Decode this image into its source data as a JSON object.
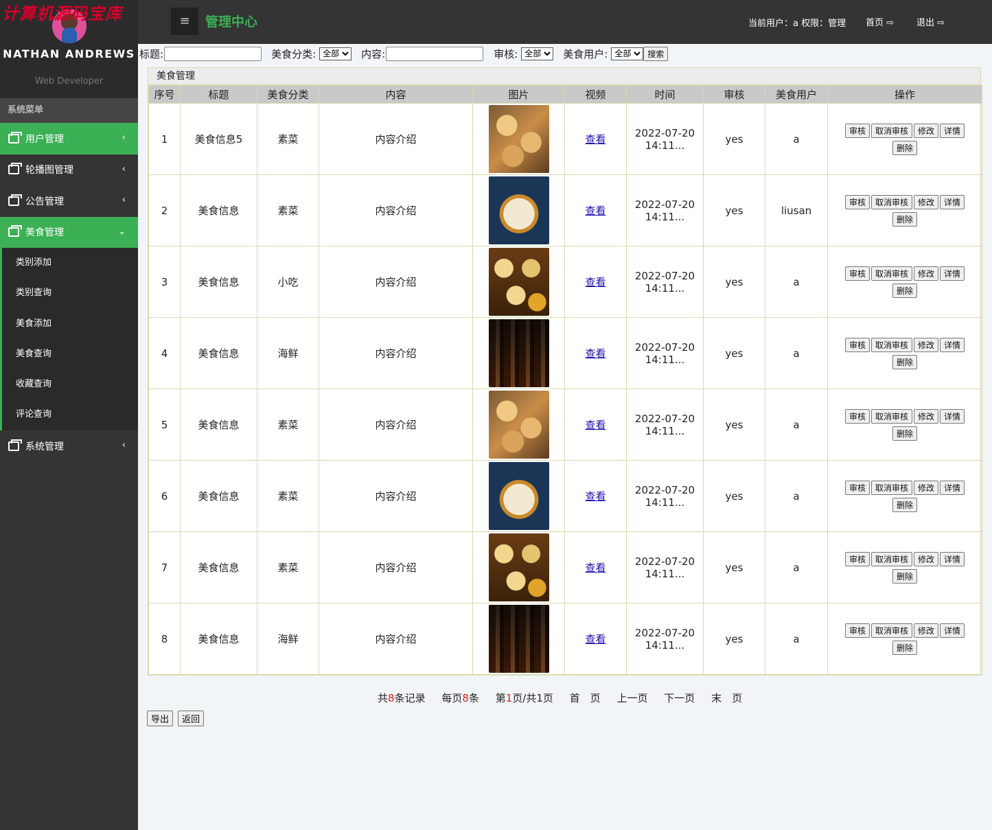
{
  "watermark": "计算机源码宝库",
  "profile": {
    "name": "NATHAN ANDREWS",
    "role": "Web Developer"
  },
  "sidebar": {
    "title": "系统菜单",
    "items": [
      {
        "label": "用户管理",
        "arrow": "‹"
      },
      {
        "label": "轮播图管理",
        "arrow": "‹"
      },
      {
        "label": "公告管理",
        "arrow": "‹"
      },
      {
        "label": "美食管理",
        "arrow": "⌄"
      }
    ],
    "subitems": [
      "类别添加",
      "类别查询",
      "美食添加",
      "美食查询",
      "收藏查询",
      "评论查询"
    ],
    "system": {
      "label": "系统管理",
      "arrow": "‹"
    }
  },
  "topbar": {
    "menu_icon": "≡",
    "title": "管理中心",
    "user_info": "当前用户：a 权限：管理",
    "home": "首页",
    "logout": "退出"
  },
  "search": {
    "title_label": "标题:",
    "category_label": "美食分类:",
    "category_value": "全部",
    "content_label": "内容:",
    "audit_label": "审核:",
    "audit_value": "全部",
    "user_label": "美食用户:",
    "user_value": "全部",
    "search_button": "搜索"
  },
  "panel_title": "美食管理",
  "columns": [
    "序号",
    "标题",
    "美食分类",
    "内容",
    "图片",
    "视频",
    "时间",
    "审核",
    "美食用户",
    "操作"
  ],
  "rows": [
    {
      "no": "1",
      "title": "美食信息5",
      "category": "素菜",
      "content": "内容介绍",
      "image": "dumplings",
      "video": "查看",
      "time1": "2022-07-20",
      "time2": "14:11...",
      "audit": "yes",
      "user": "a"
    },
    {
      "no": "2",
      "title": "美食信息",
      "category": "素菜",
      "content": "内容介绍",
      "image": "congee-bowl",
      "video": "查看",
      "time1": "2022-07-20",
      "time2": "14:11...",
      "audit": "yes",
      "user": "liusan"
    },
    {
      "no": "3",
      "title": "美食信息",
      "category": "小吃",
      "content": "内容介绍",
      "image": "dim-sum",
      "video": "查看",
      "time1": "2022-07-20",
      "time2": "14:11...",
      "audit": "yes",
      "user": "a"
    },
    {
      "no": "4",
      "title": "美食信息",
      "category": "海鲜",
      "content": "内容介绍",
      "image": "steamers",
      "video": "查看",
      "time1": "2022-07-20",
      "time2": "14:11...",
      "audit": "yes",
      "user": "a"
    },
    {
      "no": "5",
      "title": "美食信息",
      "category": "素菜",
      "content": "内容介绍",
      "image": "dumplings",
      "video": "查看",
      "time1": "2022-07-20",
      "time2": "14:11...",
      "audit": "yes",
      "user": "a"
    },
    {
      "no": "6",
      "title": "美食信息",
      "category": "素菜",
      "content": "内容介绍",
      "image": "congee-bowl",
      "video": "查看",
      "time1": "2022-07-20",
      "time2": "14:11...",
      "audit": "yes",
      "user": "a"
    },
    {
      "no": "7",
      "title": "美食信息",
      "category": "素菜",
      "content": "内容介绍",
      "image": "dim-sum",
      "video": "查看",
      "time1": "2022-07-20",
      "time2": "14:11...",
      "audit": "yes",
      "user": "a"
    },
    {
      "no": "8",
      "title": "美食信息",
      "category": "海鲜",
      "content": "内容介绍",
      "image": "steamers",
      "video": "查看",
      "time1": "2022-07-20",
      "time2": "14:11...",
      "audit": "yes",
      "user": "a"
    }
  ],
  "row_actions": [
    "审核",
    "取消审核",
    "修改",
    "详情",
    "删除"
  ],
  "pager": {
    "total_prefix": "共",
    "total": "8",
    "total_suffix": "条记录",
    "per_page_prefix": "每页",
    "per_page": "8",
    "per_page_suffix": "条",
    "page_prefix": "第",
    "page": "1",
    "page_suffix": "页/共1页",
    "first": "首　页",
    "prev": "上一页",
    "next": "下一页",
    "last": "末　页"
  },
  "bottom_buttons": {
    "export": "导出",
    "back": "返回"
  },
  "colors": {
    "accent_green": "#3cb054",
    "sidebar_bg": "#343434",
    "pager_red": "#d81e1e"
  }
}
